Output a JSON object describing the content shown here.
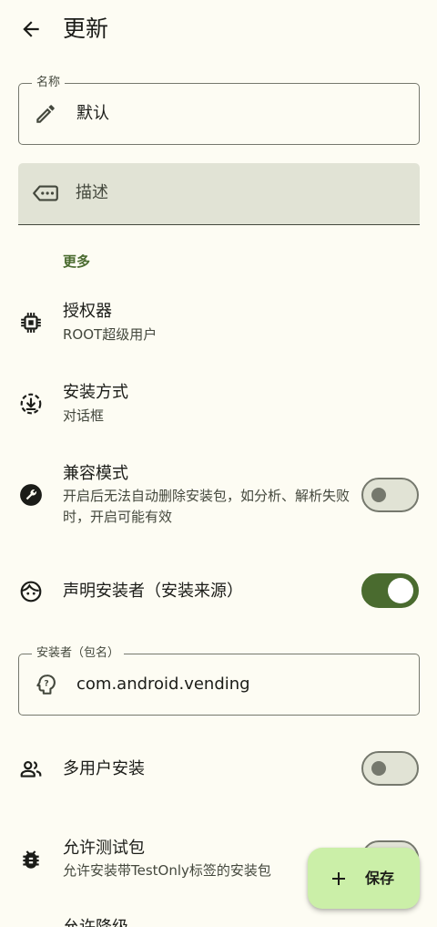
{
  "header": {
    "title": "更新",
    "back_icon": "arrow-back-icon"
  },
  "name_field": {
    "label": "名称",
    "value": "默认",
    "icon": "pencil-icon"
  },
  "description_field": {
    "placeholder": "描述",
    "icon": "label-more-icon"
  },
  "section": {
    "more_label": "更多"
  },
  "settings": {
    "authorizer": {
      "title": "授权器",
      "subtitle": "ROOT超级用户",
      "icon": "chip-icon"
    },
    "install_method": {
      "title": "安装方式",
      "subtitle": "对话框",
      "icon": "download-circle-icon"
    },
    "compat_mode": {
      "title": "兼容模式",
      "subtitle": "开启后无法自动删除安装包，如分析、解析失败时，开启可能有效",
      "icon": "wrench-icon",
      "enabled": false
    },
    "declare_installer": {
      "title": "声明安装者（安装来源）",
      "icon": "face-icon",
      "enabled": true
    },
    "multi_user": {
      "title": "多用户安装",
      "icon": "people-icon",
      "enabled": false
    },
    "allow_test": {
      "title": "允许测试包",
      "subtitle": "允许安装带TestOnly标签的安装包",
      "icon": "bug-icon",
      "enabled": false
    },
    "allow_downgrade": {
      "title": "允许降级"
    }
  },
  "installer_field": {
    "label": "安装者（包名）",
    "value": "com.android.vending",
    "icon": "question-head-icon"
  },
  "fab": {
    "label": "保存",
    "icon": "plus-icon"
  },
  "colors": {
    "background": "#fdfcf3",
    "primary": "#4a6b2f",
    "outline": "#75786d",
    "surface_variant": "#e1e3d5",
    "fab_container": "#cbefa8"
  }
}
